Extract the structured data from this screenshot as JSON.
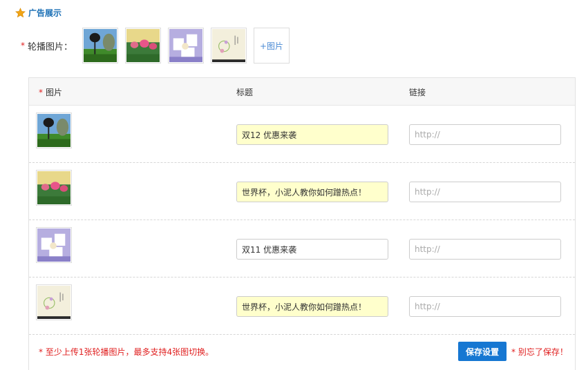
{
  "section": {
    "title": "广告展示"
  },
  "carousel": {
    "required_mark": "*",
    "label": "轮播图片：",
    "add_label": "+图片"
  },
  "table": {
    "headers": {
      "image": "图片",
      "title": "标题",
      "link": "链接"
    },
    "rows": [
      {
        "title": "双12 优惠来袭",
        "link_placeholder": "http://",
        "filled": true
      },
      {
        "title": "世界杯，小泥人教你如何蹭热点！",
        "link_placeholder": "http://",
        "filled": true
      },
      {
        "title": "双11 优惠来袭",
        "link_placeholder": "http://",
        "filled": false
      },
      {
        "title": "世界杯，小泥人教你如何蹭热点！",
        "link_placeholder": "http://",
        "filled": true
      }
    ]
  },
  "footer": {
    "note": "至少上传1张轮播图片，最多支持4张图切换。",
    "save_label": "保存设置",
    "reminder": "别忘了保存！"
  },
  "colors": {
    "accent": "#1677d2",
    "required": "#e02020",
    "section_title": "#1a6fb5",
    "filled_input": "#ffffcc"
  },
  "icons": {
    "section": "star-icon"
  }
}
